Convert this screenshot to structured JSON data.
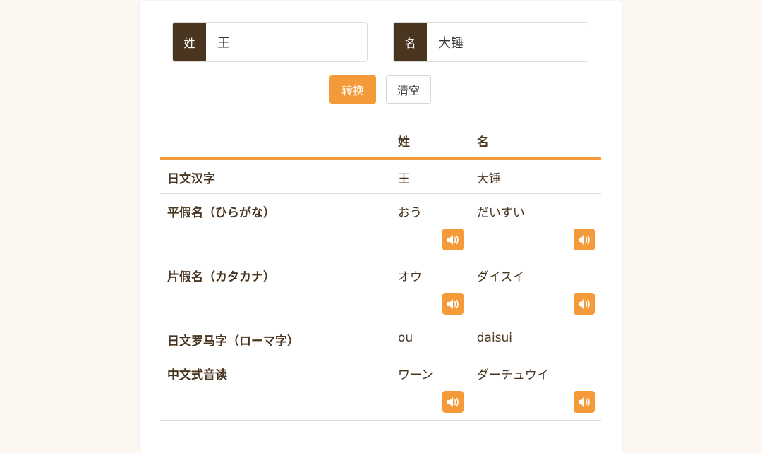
{
  "form": {
    "surname_addon": "姓",
    "surname_value": "王",
    "given_addon": "名",
    "given_value": "大锤",
    "convert_label": "转换",
    "clear_label": "清空"
  },
  "table": {
    "headers": [
      "",
      "姓",
      "名"
    ],
    "rows": [
      {
        "label": "日文汉字",
        "sur": "王",
        "giv": "大锤",
        "audio": false
      },
      {
        "label": "平假名（ひらがな）",
        "sur": "おう",
        "giv": "だいすい",
        "audio": true
      },
      {
        "label": "片假名（カタカナ）",
        "sur": "オウ",
        "giv": "ダイスイ",
        "audio": true
      },
      {
        "label": "日文罗马字（ローマ字）",
        "sur": "ou",
        "giv": "daisui",
        "audio": false
      },
      {
        "label": "中文式音读",
        "sur": "ワーン",
        "giv": "ダーチュウイ",
        "audio": true
      }
    ]
  },
  "colors": {
    "accent": "#f59a38",
    "dark": "#4a3520"
  },
  "icons": {
    "speak": "speaker-icon"
  }
}
